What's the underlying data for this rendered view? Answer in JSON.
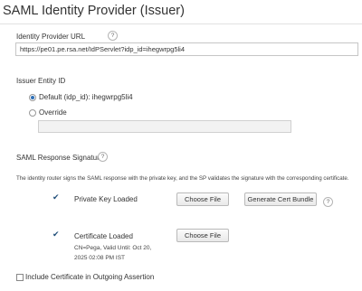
{
  "page": {
    "title": "SAML Identity Provider (Issuer)"
  },
  "idp_url": {
    "label": "Identity Provider URL",
    "value": "https://pe01.pe.rsa.net/IdPServlet?idp_id=ihegwrpg5li4"
  },
  "issuer": {
    "label": "Issuer Entity ID",
    "default_label": "Default (idp_id): ihegwrpg5li4",
    "override_label": "Override",
    "override_value": "",
    "selected": "default"
  },
  "saml_response": {
    "label": "SAML Response Signature",
    "description": "The identity router signs the SAML response with the private key, and the SP validates the signature with the corresponding certificate.",
    "private_key": {
      "label": "Private Key Loaded",
      "choose_label": "Choose File",
      "generate_label": "Generate Cert Bundle"
    },
    "certificate": {
      "label": "Certificate Loaded",
      "choose_label": "Choose File",
      "info_line1": "CN=Pega, Valid Until: Oct 20,",
      "info_line2": "2025 02:08 PM IST"
    }
  },
  "include_cert": {
    "label": "Include Certificate in Outgoing Assertion",
    "checked": false
  },
  "help_glyph": "?",
  "check_glyph": "✔",
  "icons": {
    "help": "help-circle-icon",
    "check": "checkmark-icon"
  },
  "colors": {
    "accent": "#2f6fb6",
    "check": "#1f4e79"
  }
}
